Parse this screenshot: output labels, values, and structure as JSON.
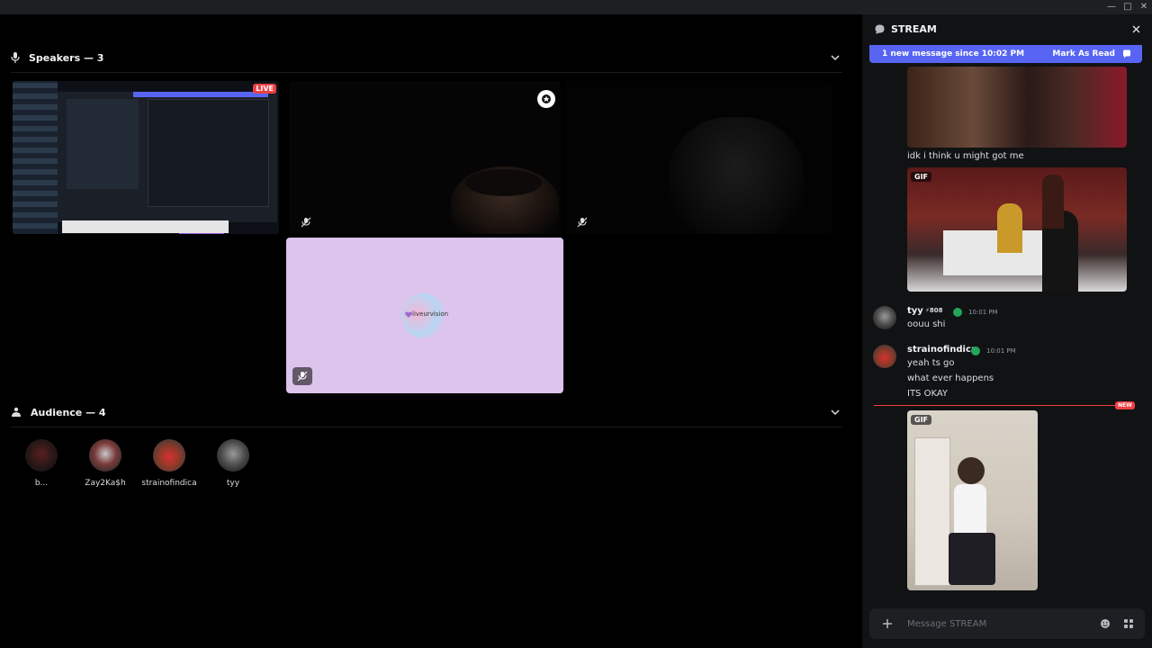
{
  "speakers": {
    "label": "Speakers — 3"
  },
  "audience": {
    "label": "Audience — 4",
    "members": [
      {
        "name": "b..."
      },
      {
        "name": "Zay2Ka$h"
      },
      {
        "name": "strainofindica"
      },
      {
        "name": "tyy"
      }
    ]
  },
  "tiles": {
    "screen_share": {
      "live_label": "LIVE"
    },
    "placeholder": {
      "brand_text": "liveurvision"
    }
  },
  "chat": {
    "channel_name": "STREAM",
    "new_bar": {
      "text": "1 new message since 10:02 PM",
      "action": "Mark As Read"
    },
    "messages": {
      "caption1": "idk i think u might got me",
      "gif_label": "GIF",
      "tyy": {
        "name": "tyy",
        "badge": "⚡808",
        "time": "10:01 PM",
        "text": "oouu shi"
      },
      "strain": {
        "name": "strainofindica",
        "time": "10:01 PM",
        "lines": [
          "yeah ts go",
          "what ever happens",
          "ITS OKAY"
        ]
      },
      "new_label": "NEW",
      "gif_label2": "GIF"
    },
    "composer_placeholder": "Message STREAM"
  },
  "colors": {
    "accent": "#5865f2",
    "live": "#ed4245",
    "new": "#f23f43",
    "verified": "#23a55a"
  }
}
